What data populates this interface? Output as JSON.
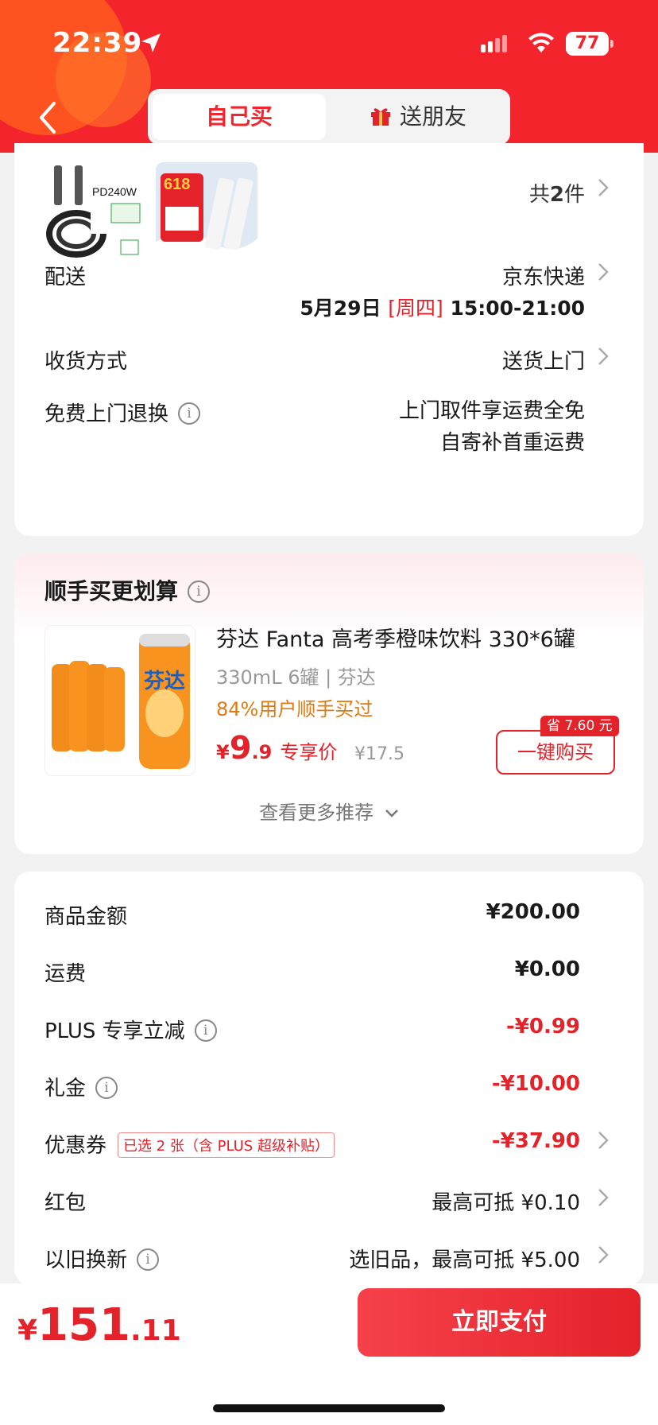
{
  "status_bar": {
    "time": "22:39",
    "battery": "77"
  },
  "header": {
    "tabs": [
      {
        "label": "自己买",
        "active": true
      },
      {
        "label": "送朋友",
        "active": false
      }
    ]
  },
  "order": {
    "count_prefix": "共",
    "count": "2",
    "count_suffix": "件",
    "product_thumbs": [
      {
        "caption": "PD240W"
      },
      {
        "caption": "618"
      }
    ],
    "rows": {
      "delivery": {
        "label": "配送",
        "value": "京东快递",
        "date": "5月29日",
        "weekday": "[周四]",
        "window": "15:00-21:00"
      },
      "receive": {
        "label": "收货方式",
        "value": "送货上门"
      },
      "returns": {
        "label": "免费上门退换",
        "line1": "上门取件享运费全免",
        "line2": "自寄补首重运费"
      }
    }
  },
  "recommend": {
    "title": "顺手买更划算",
    "product": {
      "name": "芬达 Fanta 高考季橙味饮料 330*6罐",
      "spec": "330mL 6罐 | 芬达",
      "buyers": "84%用户顺手买过",
      "price_symbol": "¥",
      "price_int": "9",
      "price_dec": ".9",
      "price_tag": "专享价",
      "original_price": "¥17.5",
      "save_badge": "省 7.60 元",
      "buy_label": "一键购买",
      "image_label": "芬达"
    },
    "more_label": "查看更多推荐"
  },
  "summary": {
    "goods": {
      "label": "商品金额",
      "value": "¥200.00"
    },
    "shipping": {
      "label": "运费",
      "value": "¥0.00"
    },
    "plus": {
      "label": "PLUS 专享立减",
      "value": "-¥0.99"
    },
    "gift": {
      "label": "礼金",
      "value": "-¥10.00"
    },
    "coupon": {
      "label": "优惠券",
      "tag": "已选 2 张（含 PLUS 超级补贴）",
      "value": "-¥37.90"
    },
    "redpacket": {
      "label": "红包",
      "value": "最高可抵 ¥0.10"
    },
    "tradein": {
      "label": "以旧换新",
      "value": "选旧品，最高可抵 ¥5.00"
    }
  },
  "footer": {
    "total_symbol": "¥",
    "total_int": "151",
    "total_dec": ".11",
    "pay_label": "立即支付"
  },
  "colors": {
    "brand": "#f4242c",
    "discount": "#e4222a",
    "accent_orange": "#e07a12"
  }
}
